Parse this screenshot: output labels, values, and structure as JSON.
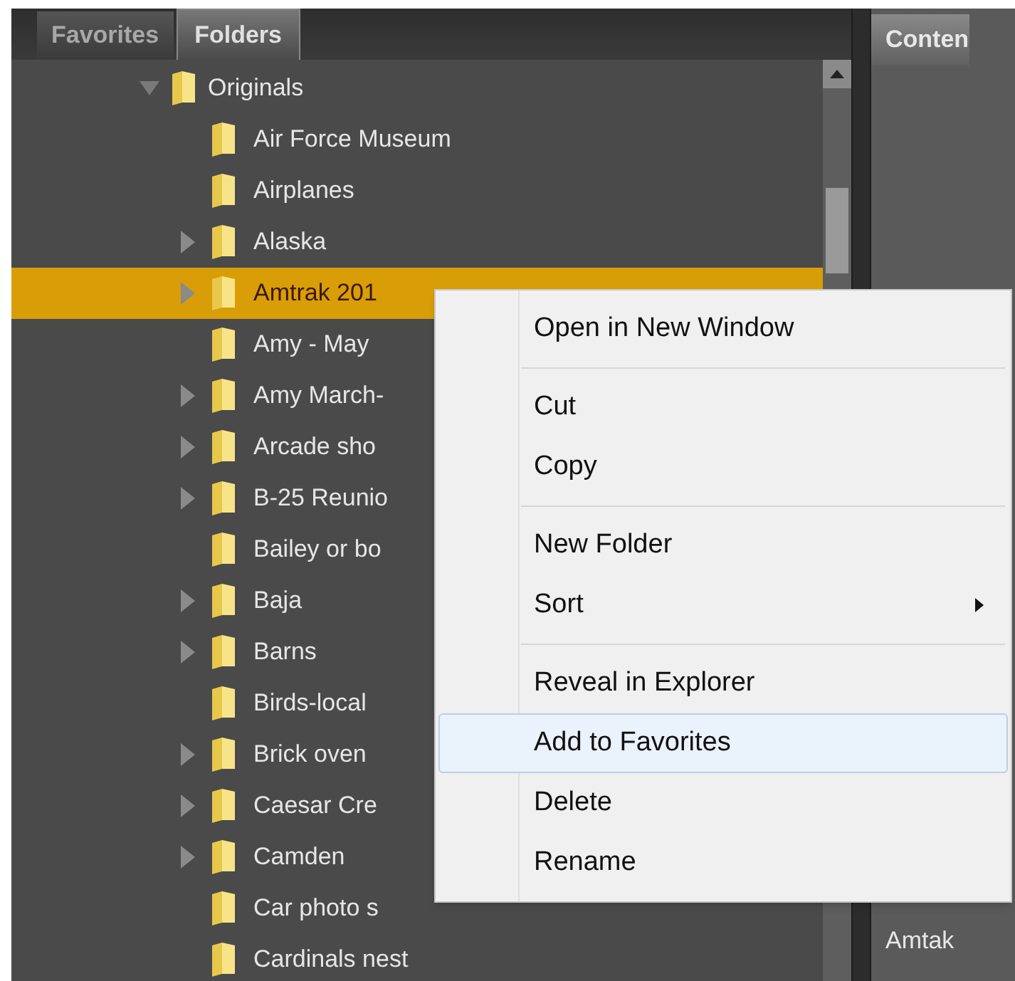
{
  "tabs": [
    {
      "label": "Favorites",
      "selected": false
    },
    {
      "label": "Folders",
      "selected": true
    }
  ],
  "tree": {
    "label": "Originals",
    "expanded": true,
    "children": [
      {
        "label": "Air Force Museum",
        "expandable": false,
        "selected": false
      },
      {
        "label": "Airplanes",
        "expandable": false,
        "selected": false
      },
      {
        "label": "Alaska",
        "expandable": true,
        "selected": false
      },
      {
        "label": "Amtrak 201",
        "expandable": true,
        "selected": true
      },
      {
        "label": "Amy - May",
        "expandable": false,
        "selected": false
      },
      {
        "label": "Amy March-",
        "expandable": true,
        "selected": false
      },
      {
        "label": "Arcade sho",
        "expandable": true,
        "selected": false
      },
      {
        "label": "B-25 Reunio",
        "expandable": true,
        "selected": false
      },
      {
        "label": "Bailey or bo",
        "expandable": false,
        "selected": false
      },
      {
        "label": "Baja",
        "expandable": true,
        "selected": false
      },
      {
        "label": "Barns",
        "expandable": true,
        "selected": false
      },
      {
        "label": "Birds-local",
        "expandable": false,
        "selected": false
      },
      {
        "label": "Brick oven",
        "expandable": true,
        "selected": false
      },
      {
        "label": "Caesar Cre",
        "expandable": true,
        "selected": false
      },
      {
        "label": "Camden",
        "expandable": true,
        "selected": false
      },
      {
        "label": "Car photo s",
        "expandable": false,
        "selected": false
      },
      {
        "label": "Cardinals nest",
        "expandable": false,
        "selected": false
      }
    ]
  },
  "content_panel": {
    "tab": "Conten",
    "item": "Amtak"
  },
  "context_menu": [
    {
      "kind": "item",
      "label": "Open in New Window",
      "selected": false,
      "submenu": false
    },
    {
      "kind": "separator"
    },
    {
      "kind": "item",
      "label": "Cut",
      "selected": false,
      "submenu": false
    },
    {
      "kind": "item",
      "label": "Copy",
      "selected": false,
      "submenu": false
    },
    {
      "kind": "separator"
    },
    {
      "kind": "item",
      "label": "New Folder",
      "selected": false,
      "submenu": false
    },
    {
      "kind": "item",
      "label": "Sort",
      "selected": false,
      "submenu": true
    },
    {
      "kind": "separator"
    },
    {
      "kind": "item",
      "label": "Reveal in Explorer",
      "selected": false,
      "submenu": false
    },
    {
      "kind": "item",
      "label": "Add to Favorites",
      "selected": true,
      "submenu": false
    },
    {
      "kind": "item",
      "label": "Delete",
      "selected": false,
      "submenu": false
    },
    {
      "kind": "item",
      "label": "Rename",
      "selected": false,
      "submenu": false
    }
  ]
}
